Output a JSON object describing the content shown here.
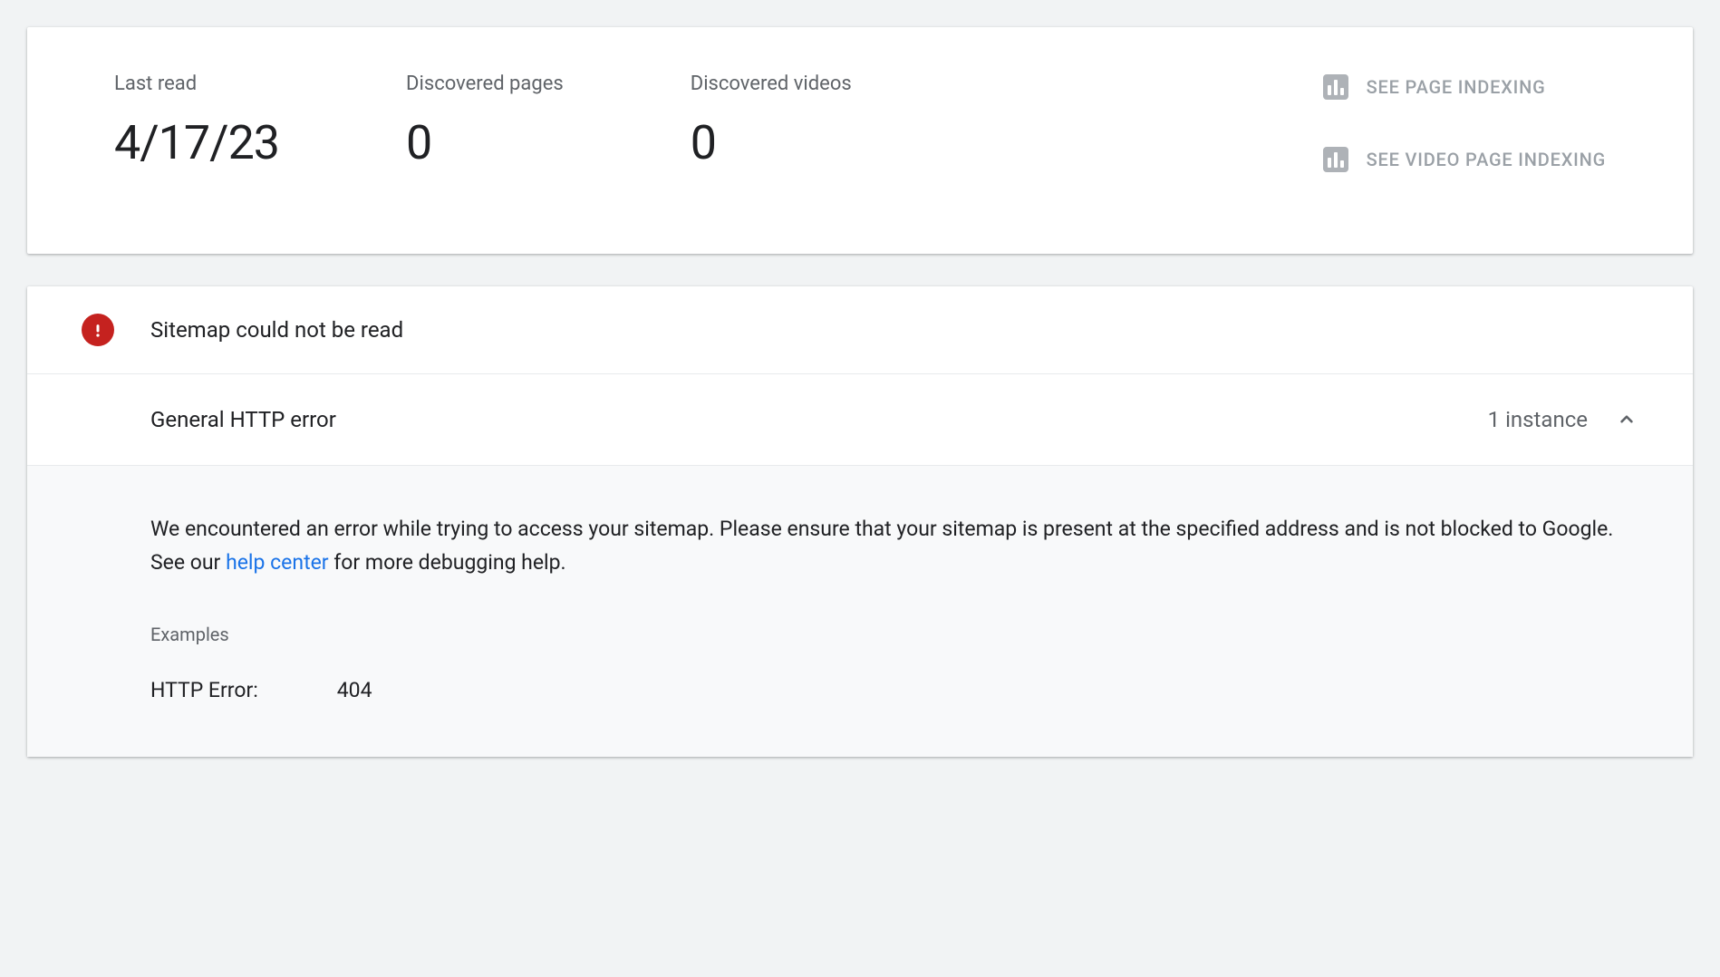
{
  "summary": {
    "lastRead": {
      "label": "Last read",
      "value": "4/17/23"
    },
    "discoveredPages": {
      "label": "Discovered pages",
      "value": "0"
    },
    "discoveredVideos": {
      "label": "Discovered videos",
      "value": "0"
    }
  },
  "actions": {
    "pageIndexing": "SEE PAGE INDEXING",
    "videoIndexing": "SEE VIDEO PAGE INDEXING"
  },
  "error": {
    "title": "Sitemap could not be read",
    "type": "General HTTP error",
    "instanceText": "1 instance",
    "descriptionPre": "We encountered an error while trying to access your sitemap. Please ensure that your sitemap is present at the specified address and is not blocked to Google. See our ",
    "helpLinkText": "help center",
    "descriptionPost": " for more debugging help.",
    "examplesLabel": "Examples",
    "example": {
      "key": "HTTP Error:",
      "value": "404"
    }
  }
}
